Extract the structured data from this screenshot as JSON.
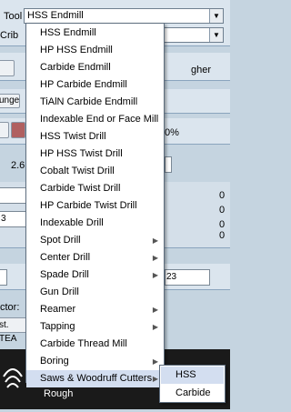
{
  "tool_label": "Tool",
  "crib_label": "Crib",
  "tool_select_value": "HSS Endmill",
  "background": {
    "right_text_1": "gher",
    "button_ange": "unge",
    "percent_text": "0%",
    "value_26": "2.6",
    "zeros": [
      "0",
      "0",
      "0",
      "0"
    ],
    "field_3": "3",
    "field_23": "23",
    "label_ctor": "ctor:",
    "button_st_tea": "st. TEA",
    "rough_label": "Rough"
  },
  "menu": {
    "items": [
      {
        "label": "HSS Endmill",
        "submenu": false
      },
      {
        "label": "HP HSS Endmill",
        "submenu": false
      },
      {
        "label": "Carbide Endmill",
        "submenu": false
      },
      {
        "label": "HP Carbide Endmill",
        "submenu": false
      },
      {
        "label": "TiAlN Carbide Endmill",
        "submenu": false
      },
      {
        "label": "Indexable End or Face Mill",
        "submenu": false
      },
      {
        "label": "HSS Twist Drill",
        "submenu": false
      },
      {
        "label": "HP HSS Twist Drill",
        "submenu": false
      },
      {
        "label": "Cobalt Twist Drill",
        "submenu": false
      },
      {
        "label": "Carbide Twist Drill",
        "submenu": false
      },
      {
        "label": "HP Carbide Twist Drill",
        "submenu": false
      },
      {
        "label": "Indexable Drill",
        "submenu": false
      },
      {
        "label": "Spot Drill",
        "submenu": true
      },
      {
        "label": "Center Drill",
        "submenu": true
      },
      {
        "label": "Spade Drill",
        "submenu": true
      },
      {
        "label": "Gun Drill",
        "submenu": false
      },
      {
        "label": "Reamer",
        "submenu": true
      },
      {
        "label": "Tapping",
        "submenu": true
      },
      {
        "label": "Carbide Thread Mill",
        "submenu": false
      },
      {
        "label": "Boring",
        "submenu": true
      },
      {
        "label": "Saws & Woodruff Cutters",
        "submenu": true
      }
    ],
    "highlighted_index": 20
  },
  "submenu": {
    "items": [
      "HSS",
      "Carbide"
    ],
    "highlighted_index": 0
  },
  "colors": {
    "highlight": "#d3def0",
    "background": "#c5d4e0"
  }
}
